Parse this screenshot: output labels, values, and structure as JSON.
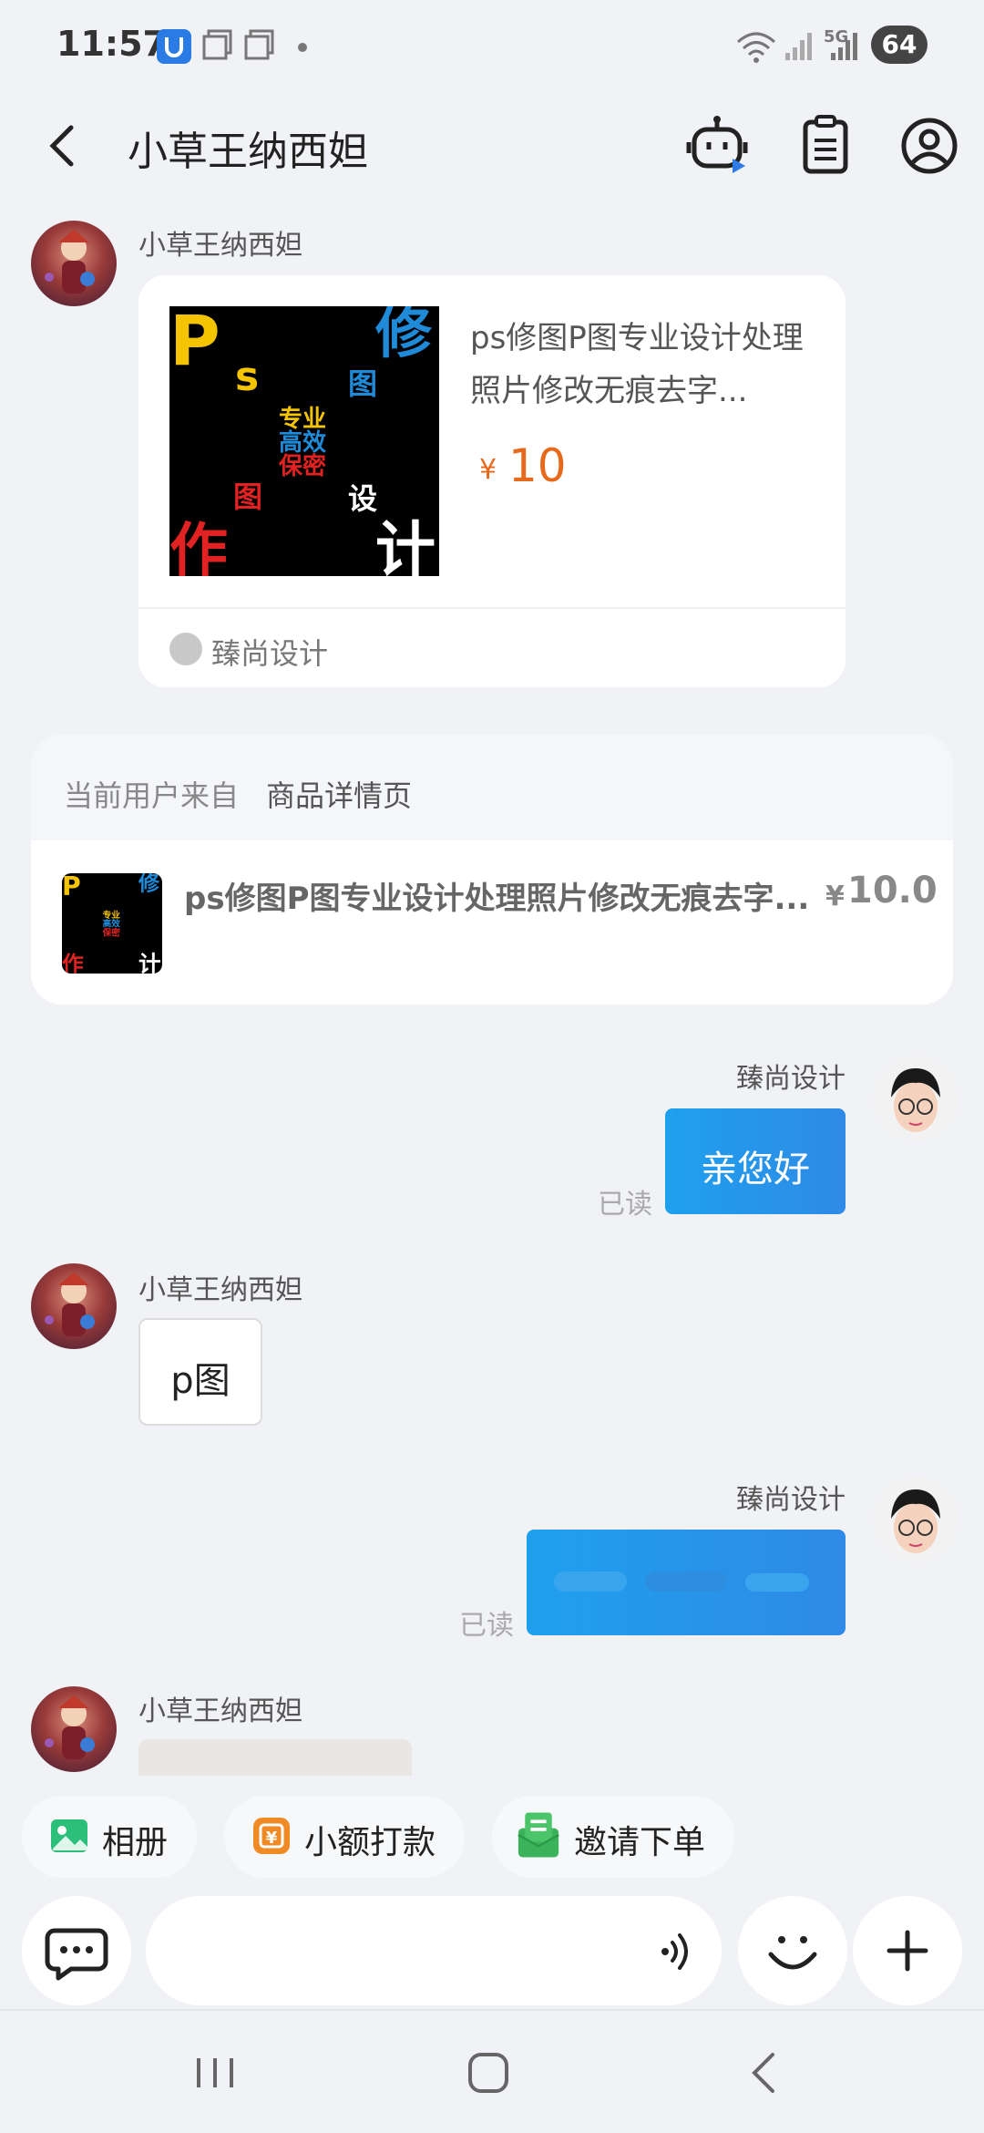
{
  "status_bar": {
    "time": "11:57",
    "battery": "64",
    "network_label": "5G"
  },
  "header": {
    "title": "小草王纳西妲"
  },
  "messages": {
    "m1_sender": "小草王纳西妲",
    "product_card": {
      "title": "ps修图P图专业设计处理照片修改无痕去字...",
      "currency": "¥",
      "price": "10",
      "shop": "臻尚设计"
    },
    "source": {
      "label": "当前用户来自",
      "page": "商品详情页",
      "product_title": "ps修图P图专业设计处理照片修改无痕去字...",
      "currency": "¥",
      "price": "10.0"
    },
    "m2_sender": "臻尚设计",
    "m2_text": "亲您好",
    "m2_status": "已读",
    "m3_sender": "小草王纳西妲",
    "m3_text": "p图",
    "m4_sender": "臻尚设计",
    "m4_status": "已读",
    "m5_sender": "小草王纳西妲"
  },
  "thumb_text": {
    "p": "P",
    "s": "s",
    "xiu": "修",
    "tu1": "图",
    "zhuanye": "专业",
    "gaoxiao": "高效",
    "baomi": "保密",
    "tu2": "图",
    "sheji": "设",
    "zuo": "作",
    "ji": "计"
  },
  "quick_actions": [
    {
      "label": "相册",
      "icon": "photo-album-icon",
      "color": "#2bbf7a"
    },
    {
      "label": "小额打款",
      "icon": "payment-icon",
      "color": "#f08a24"
    },
    {
      "label": "邀请下单",
      "icon": "invite-order-icon",
      "color": "#3bb35a"
    }
  ],
  "colors": {
    "accent_blue": "#2196ec",
    "price_orange": "#e76a1c"
  }
}
